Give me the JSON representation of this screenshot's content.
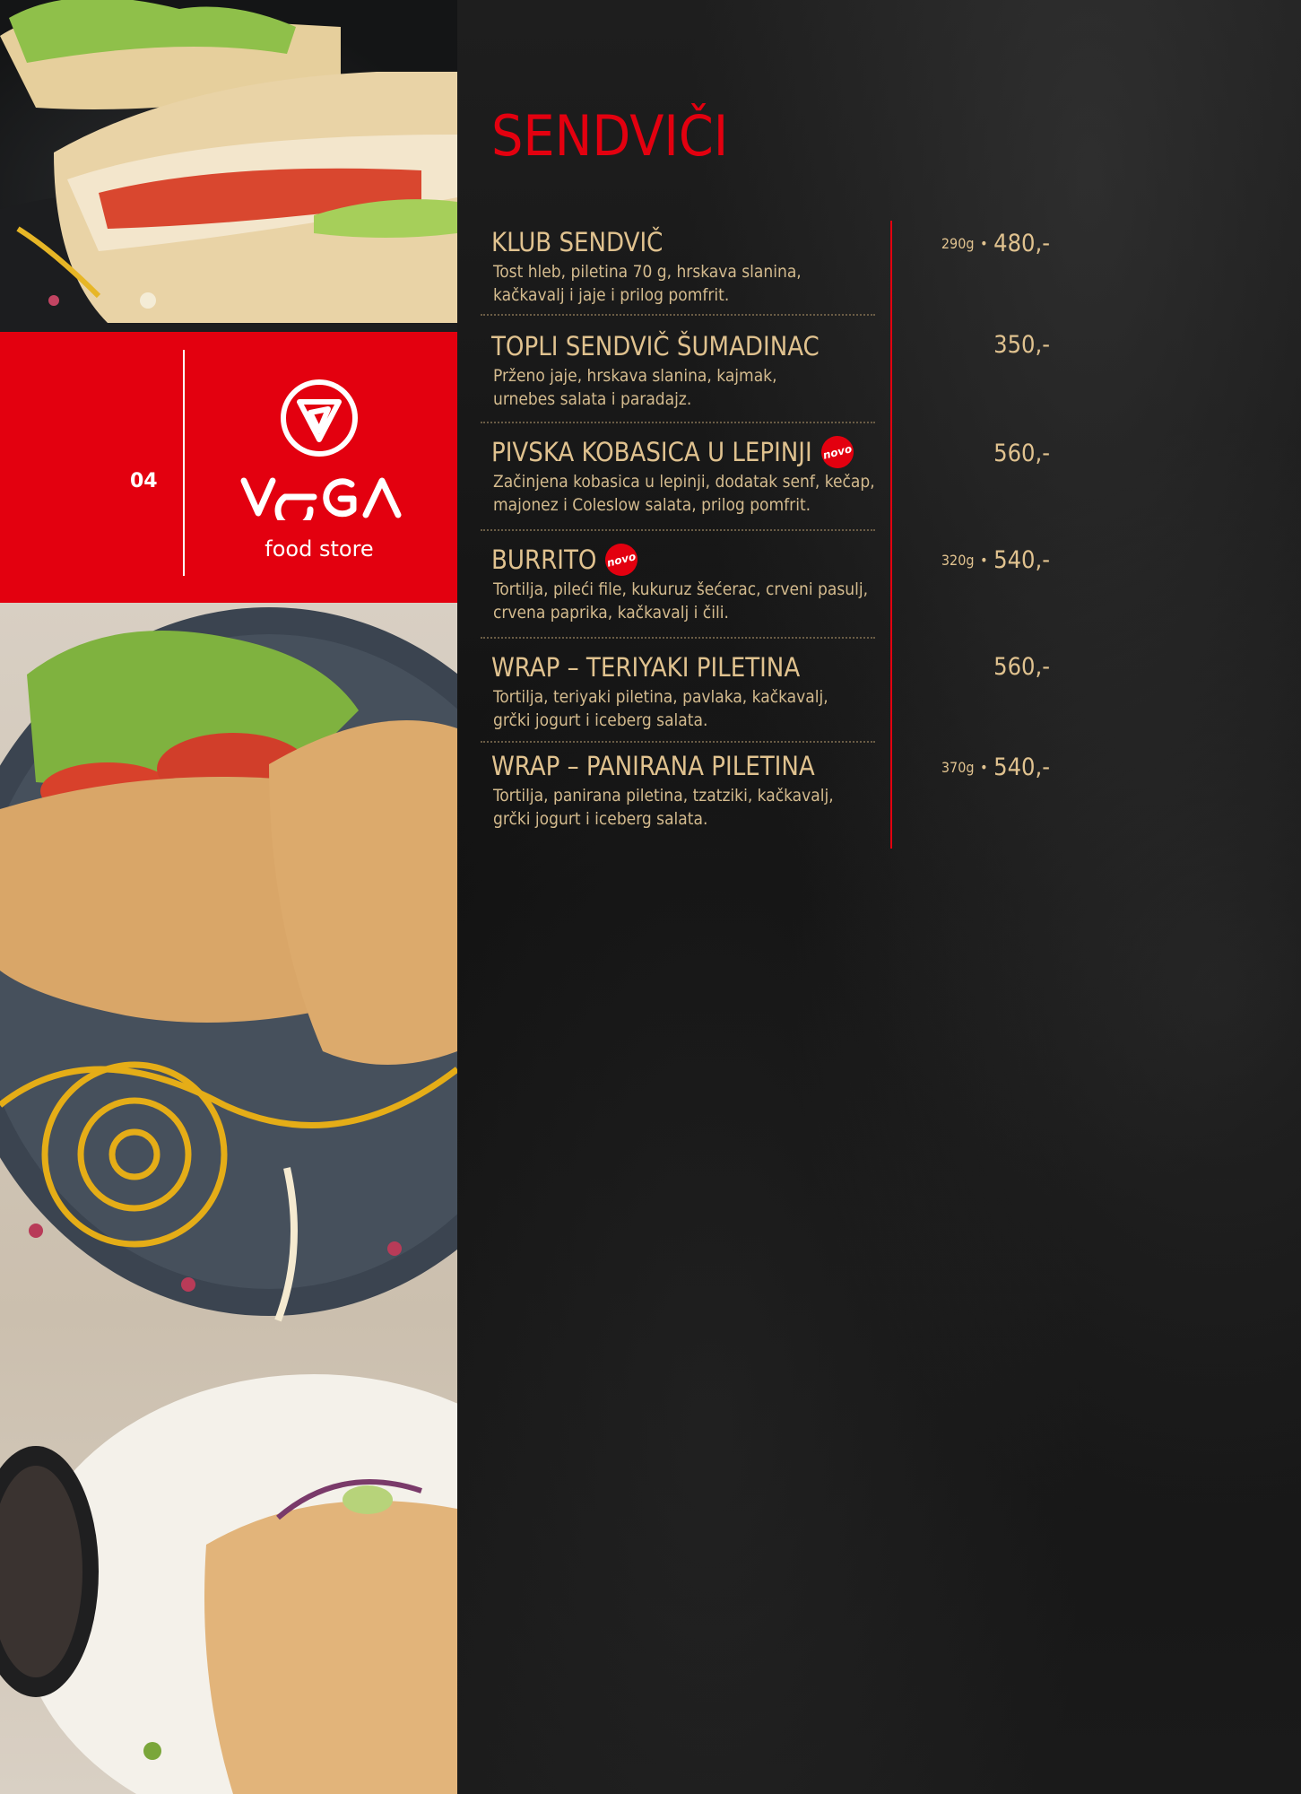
{
  "page": {
    "number": "04",
    "brand": {
      "name": "VEGA",
      "subtitle": "food store"
    }
  },
  "colors": {
    "accent": "#e3000f",
    "text_gold": "#e0c28f",
    "background": "#151515"
  },
  "section": {
    "title": "SENDVIČI"
  },
  "badge_label": "novo",
  "items": [
    {
      "name": "KLUB SENDVIČ",
      "desc_line1": "Tost hleb, piletina 70 g, hrskava slanina,",
      "desc_line2": "kačkavalj i jaje i prilog pomfrit.",
      "weight": "290g",
      "price": "480,-",
      "is_new": false
    },
    {
      "name": "TOPLI SENDVIČ ŠUMADINAC",
      "desc_line1": "Prženo jaje, hrskava slanina, kajmak,",
      "desc_line2": "urnebes salata i paradajz.",
      "weight": "",
      "price": "350,-",
      "is_new": false
    },
    {
      "name": "PIVSKA KOBASICA U LEPINJI",
      "desc_line1": "Začinjena kobasica u lepinji, dodatak senf, kečap,",
      "desc_line2": "majonez i Coleslow salata, prilog pomfrit.",
      "weight": "",
      "price": "560,-",
      "is_new": true
    },
    {
      "name": "BURRITO",
      "desc_line1": "Tortilja, pileći file, kukuruz šećerac, crveni pasulj,",
      "desc_line2": "crvena paprika, kačkavalj i čili.",
      "weight": "320g",
      "price": "540,-",
      "is_new": true
    },
    {
      "name": "WRAP – TERIYAKI PILETINA",
      "desc_line1": "Tortilja, teriyaki piletina, pavlaka, kačkavalj,",
      "desc_line2": "grčki jogurt i iceberg salata.",
      "weight": "",
      "price": "560,-",
      "is_new": false
    },
    {
      "name": "WRAP – PANIRANA PILETINA",
      "desc_line1": "Tortilja, panirana piletina, tzatziki, kačkavalj,",
      "desc_line2": "grčki jogurt i iceberg salata.",
      "weight": "370g",
      "price": "540,-",
      "is_new": false
    }
  ],
  "images": [
    {
      "name": "sandwich-photo",
      "depicts": "toasted sandwich with tomato and lettuce"
    },
    {
      "name": "sandwich-plate-photo",
      "depicts": "filled bread pockets on dark plate with sauces"
    }
  ]
}
